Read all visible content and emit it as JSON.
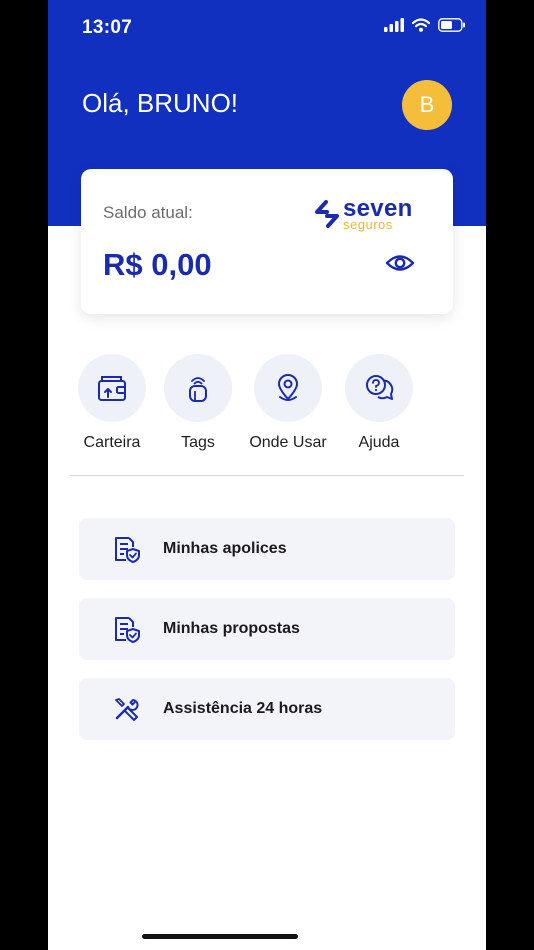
{
  "status_bar": {
    "time": "13:07"
  },
  "header": {
    "greeting": "Olá, BRUNO!",
    "avatar_initial": "B"
  },
  "balance_card": {
    "label": "Saldo atual:",
    "value": "R$ 0,00",
    "brand_name": "seven",
    "brand_sub": "seguros"
  },
  "quick_actions": [
    {
      "label": "Carteira",
      "icon": "wallet-icon"
    },
    {
      "label": "Tags",
      "icon": "tag-icon"
    },
    {
      "label": "Onde Usar",
      "icon": "location-pin-icon"
    },
    {
      "label": "Ajuda",
      "icon": "help-chat-icon"
    }
  ],
  "menu": [
    {
      "label": "Minhas apolices",
      "icon": "document-shield-icon"
    },
    {
      "label": "Minhas propostas",
      "icon": "document-shield-icon"
    },
    {
      "label": "Assistência 24 horas",
      "icon": "tools-icon"
    }
  ],
  "colors": {
    "primary": "#1230c0",
    "accent": "#f4be3a",
    "card_bg": "#f3f4f9"
  }
}
